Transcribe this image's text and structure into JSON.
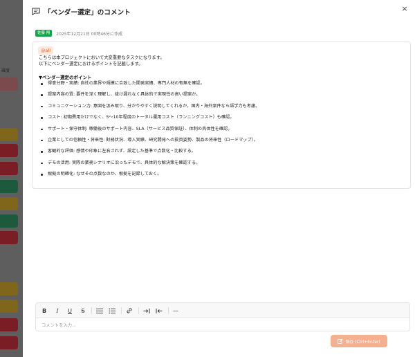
{
  "background": {
    "side_text": "確度"
  },
  "header": {
    "title": "「ベンダー選定」のコメント",
    "close_label": "×"
  },
  "comment": {
    "author": "佐藤 翔",
    "timestamp": "2025年12月21日 00時46分に作成",
    "mention": "@all",
    "intro_lines": [
      "こちらは本プロジェクトにおいて大変重要なタスクになります。",
      "以下にベンダー選定におけるポイントを記載します。"
    ],
    "section_title": "▼ベンダー選定のポイント",
    "points": [
      "得意分野・実績: 自社の業界や規模に合致した開発実績、専門人材の有無を確認。",
      "提案内容の質: 要件を深く理解し、抜け漏れなく具体的で実現性の高い提案か。",
      "コミュニケーション力: 意図を汲み取り、分かりやすく説明してくれるか。国内・海外案件なら語学力も考慮。",
      "コスト: 初期費用だけでなく、5〜10年程度のトータル運用コスト（ランニングコスト）も確認。",
      "サポート・保守体制: 稼働後のサポート内容、SLA（サービス品質保証）、体制の具体性を確認。",
      "企業としての信頼性・将来性: 財務状況、導入実績、研究開発への投資姿勢、製品の将来性（ロードマップ）。",
      "客観的な評価: 感情や印象に左右されず、設定した基準で点数化・比較する。",
      "デモの活用: 実際の業務シナリオに沿ったデモで、具体的な解決策を確認する。",
      "根拠の明確化: なぜその点数なのか、根拠を記録しておく。"
    ]
  },
  "editor": {
    "placeholder": "コメントを入力...",
    "toolbar": {
      "bold": "B",
      "italic": "I",
      "underline": "U",
      "strike": "S",
      "horizontal_rule": "—"
    },
    "save_label": "保存 (Ctrl+Enter)"
  },
  "colors": {
    "accent": "#f5b08f",
    "author_badge": "#16a34a",
    "mention_text": "#e0643a",
    "mention_bg": "#fde8dd"
  }
}
